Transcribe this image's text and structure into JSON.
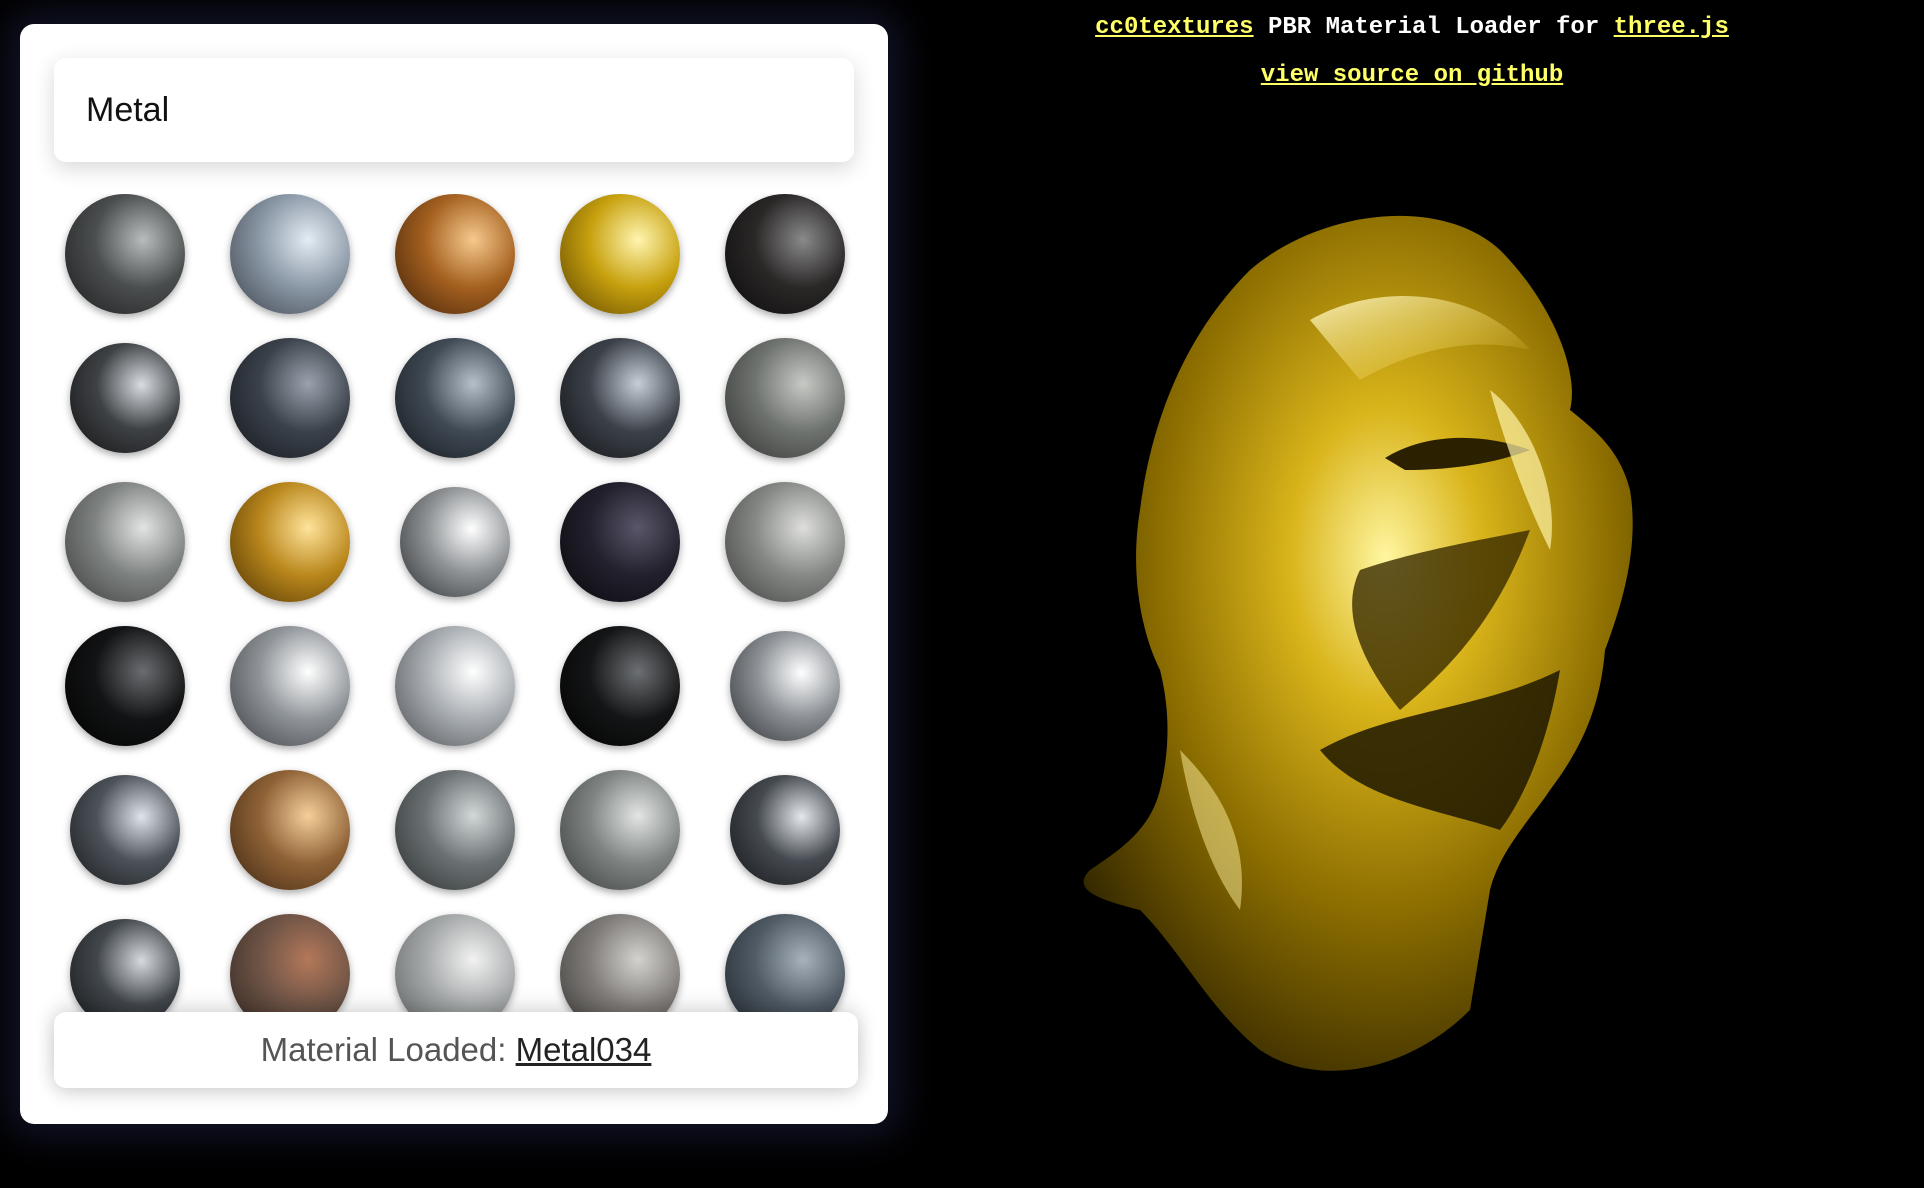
{
  "search": {
    "value": "Metal"
  },
  "status": {
    "prefix": "Material Loaded: ",
    "material": "Metal034"
  },
  "header": {
    "link1": "cc0textures",
    "middle": " PBR Material Loader for ",
    "link2": "three.js",
    "source_link": "view source on github"
  },
  "materials": [
    {
      "c1": "#b8bcbc",
      "c2": "#4b4e4f",
      "c3": "#1a1b1c"
    },
    {
      "c1": "#e4ecf4",
      "c2": "#8b98a6",
      "c3": "#3a4048"
    },
    {
      "c1": "#f6c98c",
      "c2": "#a4601f",
      "c3": "#3e1f08"
    },
    {
      "c1": "#fff5b0",
      "c2": "#c7a10e",
      "c3": "#5b4200"
    },
    {
      "c1": "#8a8a8a",
      "c2": "#2a2727",
      "c3": "#0a0909"
    },
    {
      "c1": "#d9dde2",
      "c2": "#3f4245",
      "c3": "#101112"
    },
    {
      "c1": "#9aa3ad",
      "c2": "#3a414b",
      "c3": "#14171b"
    },
    {
      "c1": "#b6c0cb",
      "c2": "#404a55",
      "c3": "#12161a"
    },
    {
      "c1": "#c6ced7",
      "c2": "#3c4149",
      "c3": "#0f1114"
    },
    {
      "c1": "#c7c9c5",
      "c2": "#6f736f",
      "c3": "#2e302e"
    },
    {
      "c1": "#e2e4e3",
      "c2": "#7e8280",
      "c3": "#3a3c3b"
    },
    {
      "c1": "#ffe39a",
      "c2": "#b9871c",
      "c3": "#4a2f00"
    },
    {
      "c1": "#ffffff",
      "c2": "#8f9396",
      "c3": "#2c2e30"
    },
    {
      "c1": "#5a566a",
      "c2": "#22202c",
      "c3": "#08070b"
    },
    {
      "c1": "#dedfdc",
      "c2": "#858884",
      "c3": "#3d3f3c"
    },
    {
      "c1": "#6a6d70",
      "c2": "#121314",
      "c3": "#000000"
    },
    {
      "c1": "#ffffff",
      "c2": "#8f9499",
      "c3": "#3a3c3f"
    },
    {
      "c1": "#ffffff",
      "c2": "#a8adb2",
      "c3": "#4a4d50"
    },
    {
      "c1": "#6d7073",
      "c2": "#141516",
      "c3": "#000000"
    },
    {
      "c1": "#ffffff",
      "c2": "#8c9196",
      "c3": "#2d2f31"
    },
    {
      "c1": "#dfe4ea",
      "c2": "#4d535a",
      "c3": "#16181b"
    },
    {
      "c1": "#f4cf9a",
      "c2": "#8f6236",
      "c3": "#3a2410"
    },
    {
      "c1": "#d2d7d8",
      "c2": "#6b7173",
      "c3": "#2a2d2e"
    },
    {
      "c1": "#e2e5e3",
      "c2": "#7f8482",
      "c3": "#363937"
    },
    {
      "c1": "#e4e8ed",
      "c2": "#454a50",
      "c3": "#121417"
    },
    {
      "c1": "#d6dadf",
      "c2": "#42474c",
      "c3": "#131517"
    },
    {
      "c1": "#b4785a",
      "c2": "#6e5446",
      "c3": "#2f2520"
    },
    {
      "c1": "#f2f2f2",
      "c2": "#a5a8a9",
      "c3": "#5c5f60"
    },
    {
      "c1": "#d4d2cf",
      "c2": "#7f7c79",
      "c3": "#3a3836"
    },
    {
      "c1": "#a7b2bc",
      "c2": "#505b66",
      "c3": "#1d2328"
    }
  ]
}
